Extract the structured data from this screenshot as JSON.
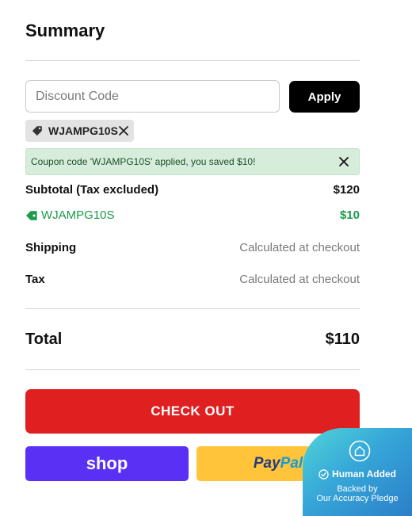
{
  "summary": {
    "title": "Summary",
    "discount": {
      "placeholder": "Discount Code",
      "value": "",
      "apply_label": "Apply"
    },
    "applied_code_chip": "WJAMPG10S",
    "notice": "Coupon code 'WJAMPG10S' applied, you saved $10!",
    "subtotal": {
      "label": "Subtotal (Tax excluded)",
      "value": "$120"
    },
    "discount_line": {
      "label": "WJAMPG10S",
      "value": "$10"
    },
    "shipping": {
      "label": "Shipping",
      "value": "Calculated at checkout"
    },
    "tax": {
      "label": "Tax",
      "value": "Calculated at checkout"
    },
    "total": {
      "label": "Total",
      "value": "$110"
    },
    "checkout_label": "CHECK OUT",
    "shop_label": "shop",
    "paypal": {
      "part1": "Pay",
      "part2": "Pal"
    }
  },
  "badge": {
    "title": "Human Added",
    "line1": "Backed by",
    "line2": "Our Accuracy Pledge"
  },
  "colors": {
    "checkout": "#e02020",
    "shop": "#5a31f4",
    "paypal": "#ffc439",
    "discount_green": "#1a9a4a",
    "notice_bg": "#d7eddc"
  },
  "icons": [
    "tag-icon",
    "close-icon",
    "home-shield-icon",
    "check-circle-icon"
  ]
}
